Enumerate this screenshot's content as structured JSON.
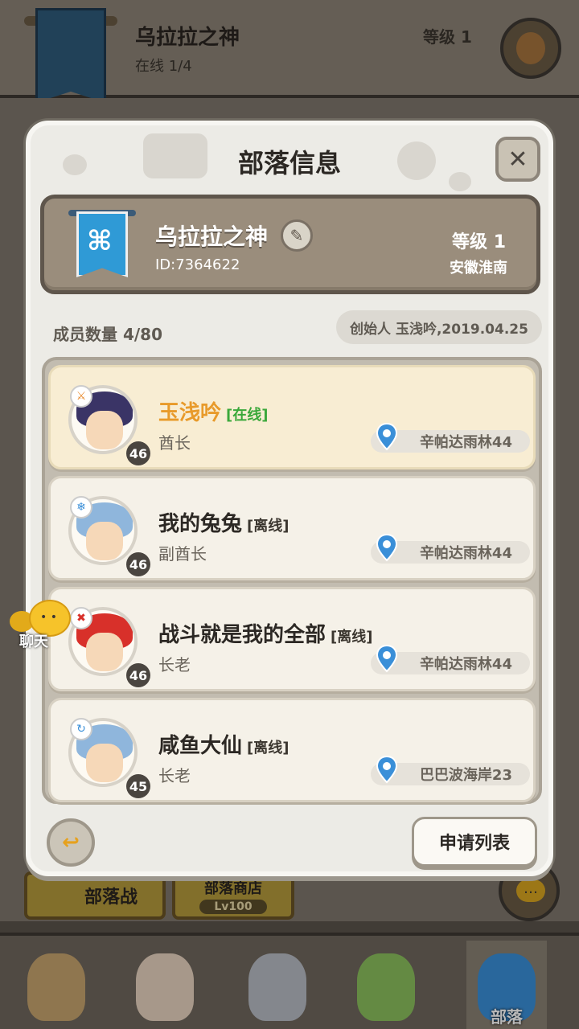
{
  "background": {
    "tribe_name": "乌拉拉之神",
    "online": "在线 1/4",
    "level": "等级 1",
    "buttons": {
      "tribe_war": "部落战",
      "tribe_shop": "部落商店",
      "shop_level": "Lv100"
    },
    "nav": {
      "active_label": "部落"
    }
  },
  "modal": {
    "title": "部落信息",
    "tribe": {
      "name": "乌拉拉之神",
      "id": "ID:7364622",
      "level": "等级 1",
      "region": "安徽淮南",
      "banner_color": "#2f9ad6"
    },
    "members_count": "成员数量 4/80",
    "founder": "创始人 玉浅吟,2019.04.25",
    "members": [
      {
        "name": "玉浅吟",
        "status": "[在线]",
        "role": "酋长",
        "level": "46",
        "location": "辛帕达雨林44",
        "leader": true,
        "hair_color": "#3a3466"
      },
      {
        "name": "我的兔兔",
        "status": "[离线]",
        "role": "副酋长",
        "level": "46",
        "location": "辛帕达雨林44",
        "leader": false,
        "hair_color": "#8fb6dc"
      },
      {
        "name": "战斗就是我的全部",
        "status": "[离线]",
        "role": "长老",
        "level": "46",
        "location": "辛帕达雨林44",
        "leader": false,
        "hair_color": "#d8302a"
      },
      {
        "name": "咸鱼大仙",
        "status": "[离线]",
        "role": "长老",
        "level": "45",
        "location": "巴巴波海岸23",
        "leader": false,
        "hair_color": "#8fb6dc"
      }
    ],
    "apply_list": "申请列表"
  },
  "chat": {
    "label": "聊天"
  },
  "colors": {
    "leader_name": "#e89a2a",
    "online_status": "#3aa83a",
    "pin": "#3a8fd8"
  },
  "icons": [
    "close-icon",
    "edit-icon",
    "location-pin-icon",
    "back-arrow-icon",
    "chat-bubble-icon",
    "banner-icon"
  ]
}
